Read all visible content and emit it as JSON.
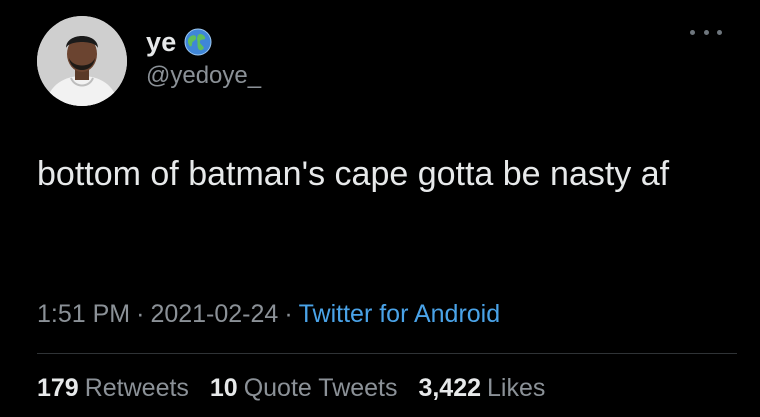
{
  "tweet": {
    "author": {
      "display_name": "ye",
      "handle": "@yedoye_",
      "badge_icon": "globe-icon",
      "avatar_icon": "avatar"
    },
    "text": "bottom of batman's cape gotta be nasty af",
    "meta": {
      "time": "1:51 PM",
      "date": "2021-02-24",
      "separator": "·",
      "source": "Twitter for Android"
    },
    "stats": {
      "retweets_count": "179",
      "retweets_label": "Retweets",
      "quotes_count": "10",
      "quotes_label": "Quote Tweets",
      "likes_count": "3,422",
      "likes_label": "Likes"
    },
    "more_icon": "more-horizontal-icon"
  },
  "colors": {
    "background": "#000000",
    "text_primary": "#e7e9ea",
    "text_secondary": "#8b9197",
    "link": "#4aa3e8",
    "divider": "#2f3336"
  }
}
